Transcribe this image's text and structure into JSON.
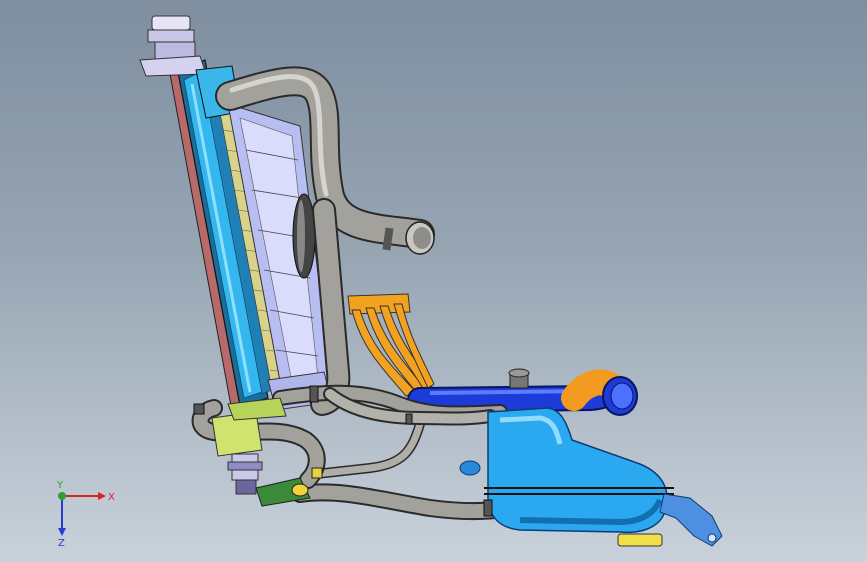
{
  "viewport": {
    "background_top": "#7f8fa0",
    "background_bottom": "#c9d2db"
  },
  "triad": {
    "x_label": "X",
    "y_label": "Y",
    "z_label": "Z",
    "x_color": "#e02020",
    "y_color": "#2fa02f",
    "z_color": "#2a3ad0"
  },
  "assembly": {
    "radiator_core_color": "#33b7ee",
    "radiator_seal_color": "#b86a6a",
    "radiator_cap_color": "#c9c7e8",
    "fan_shroud_color": "#aab0f0",
    "hose_color": "#9e9c98",
    "bracket_color": "#f3a21f",
    "upper_pipe_color": "#1c3bd8",
    "reservoir_color": "#2aa8f0",
    "mount_bracket_color": "#4f8fe2",
    "pump_color": "#cfe36e"
  }
}
